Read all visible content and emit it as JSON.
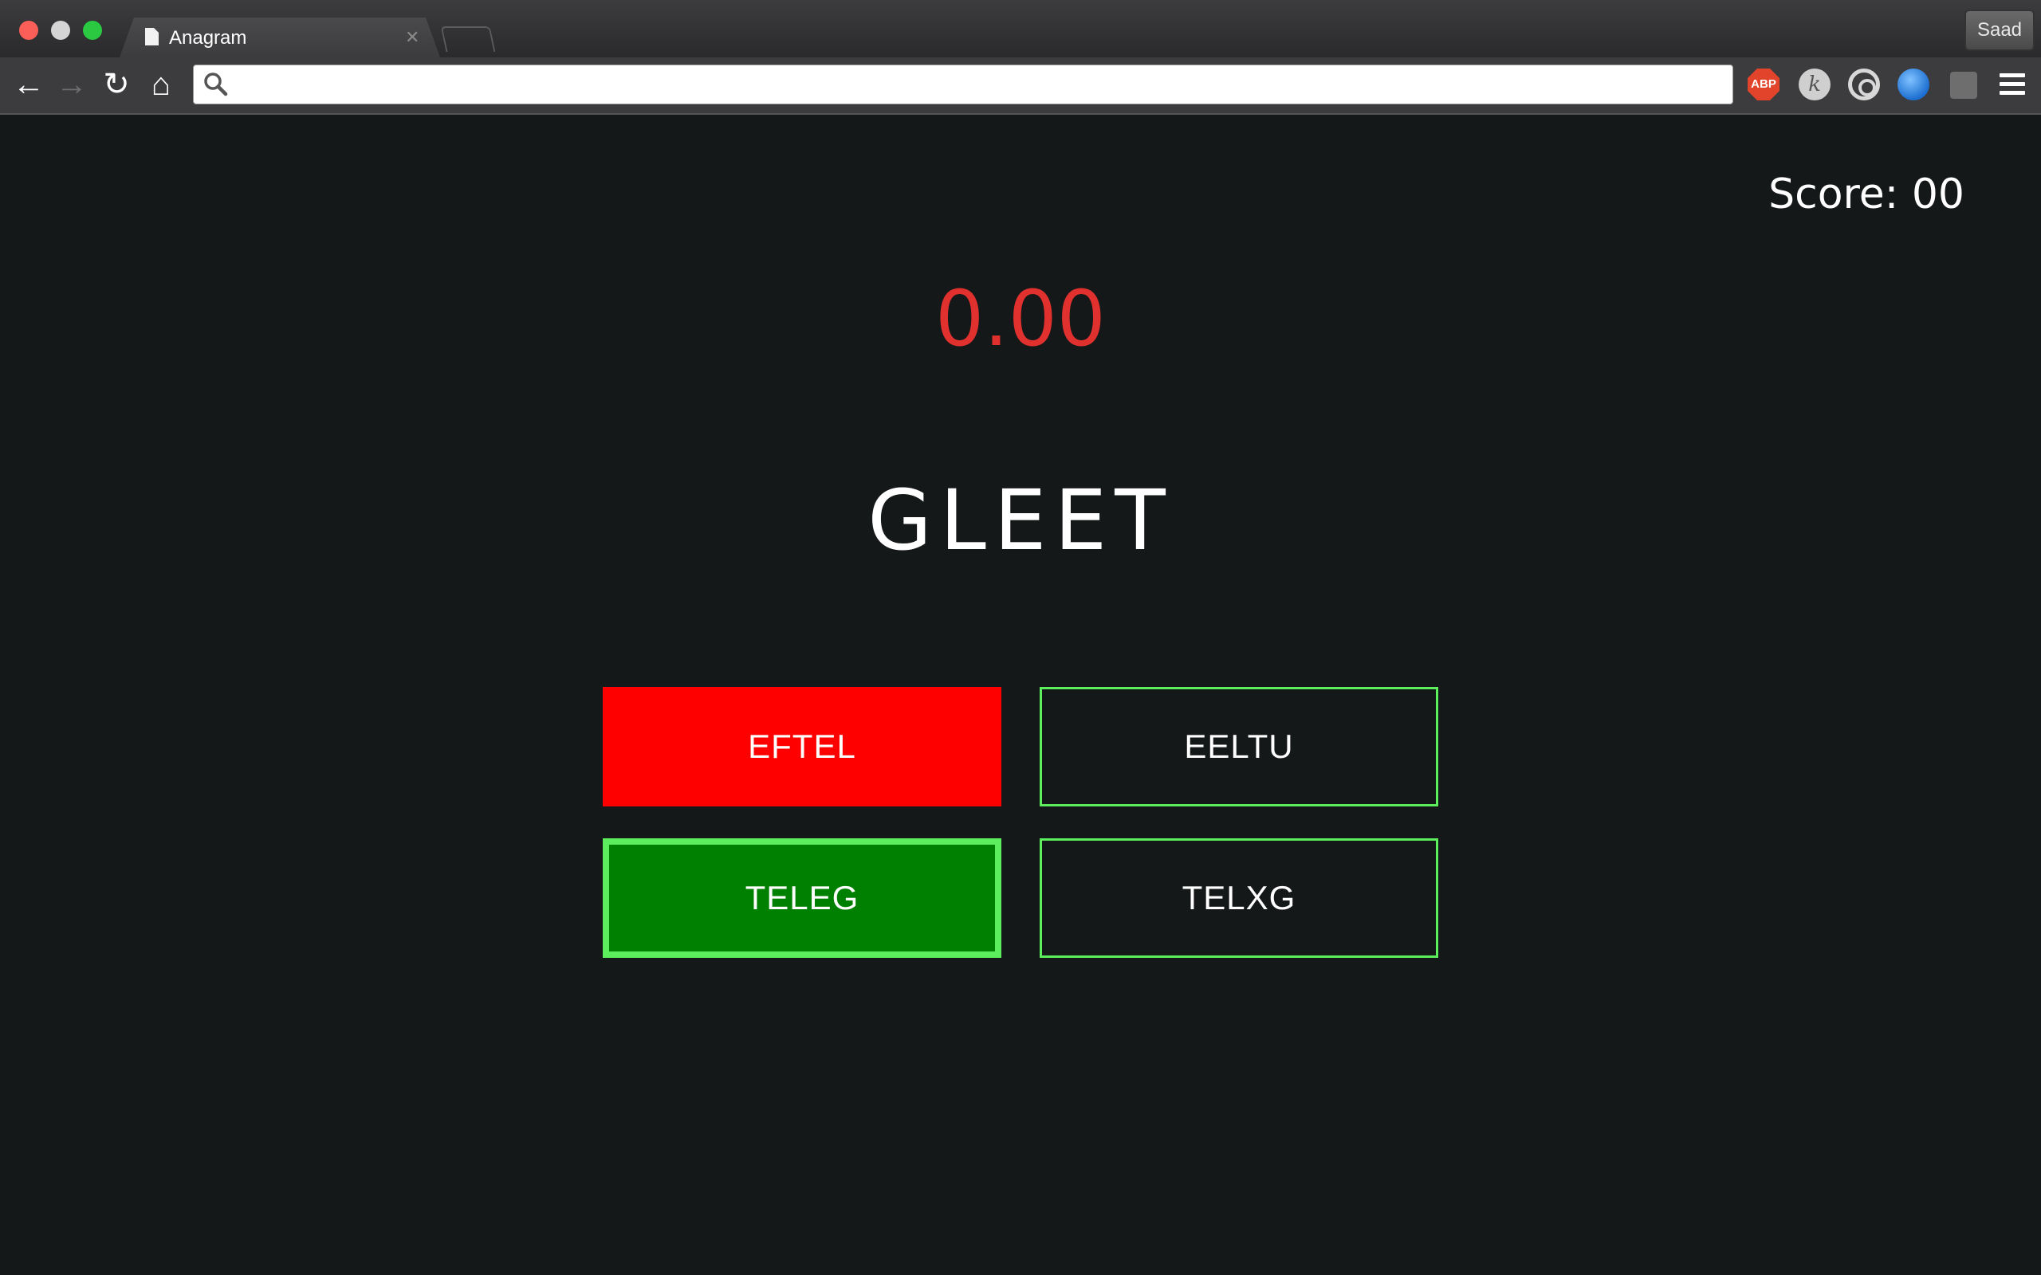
{
  "browser": {
    "tab_title": "Anagram",
    "tab_close_glyph": "✕",
    "profile_name": "Saad",
    "omnibox": {
      "value": "",
      "placeholder": ""
    },
    "extensions": [
      {
        "name": "adblock-plus-icon",
        "label": "ABP",
        "color": "#e2442b"
      },
      {
        "name": "k-extension-icon",
        "label": "k"
      },
      {
        "name": "at-sign-extension-icon"
      },
      {
        "name": "globe-extension-icon"
      },
      {
        "name": "puzzle-extension-icon"
      }
    ],
    "nav": {
      "back_glyph": "←",
      "forward_glyph": "→",
      "reload_glyph": "↻",
      "home_glyph": "⌂"
    }
  },
  "game": {
    "score_text": "Score: 00",
    "timer_text": "0.00",
    "word": "GLEET",
    "options": [
      {
        "label": "EFTEL",
        "state": "wrong"
      },
      {
        "label": "EELTU",
        "state": "neutral"
      },
      {
        "label": "TELEG",
        "state": "correct"
      },
      {
        "label": "TELXG",
        "state": "neutral"
      }
    ]
  },
  "colors": {
    "background": "#151819",
    "timer": "#e0312f",
    "wrong": "#ff0000",
    "correct": "#008000",
    "option_border": "#5dee5d"
  }
}
